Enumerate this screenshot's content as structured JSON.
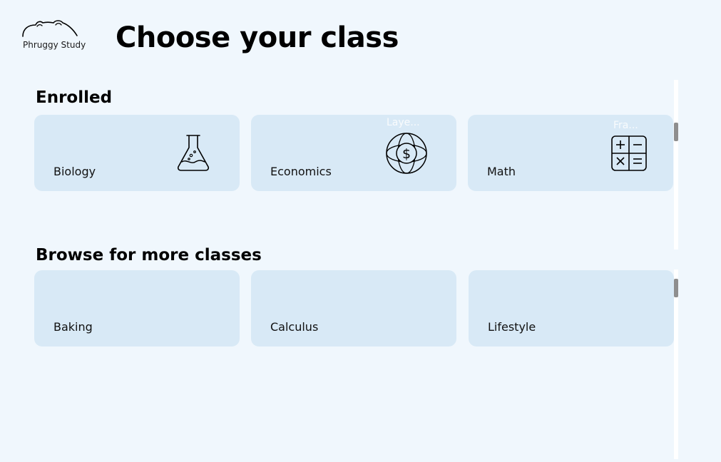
{
  "logo": {
    "text": "Phruggy Study",
    "icon": "frog-outline-icon"
  },
  "page": {
    "title": "Choose your class"
  },
  "enrolled": {
    "title": "Enrolled",
    "cards": [
      {
        "label": "Biology",
        "icon": "flask-icon"
      },
      {
        "label": "Economics",
        "icon": "coin-dollar-icon"
      },
      {
        "label": "Math",
        "icon": "calculator-icon"
      }
    ],
    "ghost_labels": [
      "Laye...",
      "Fra..."
    ]
  },
  "browse": {
    "title": "Browse for more classes",
    "cards": [
      {
        "label": "Baking"
      },
      {
        "label": "Calculus"
      },
      {
        "label": "Lifestyle"
      }
    ]
  },
  "colors": {
    "background": "#f0f7fd",
    "card": "#d8e9f6",
    "scroll_thumb": "#8e8e8e"
  }
}
